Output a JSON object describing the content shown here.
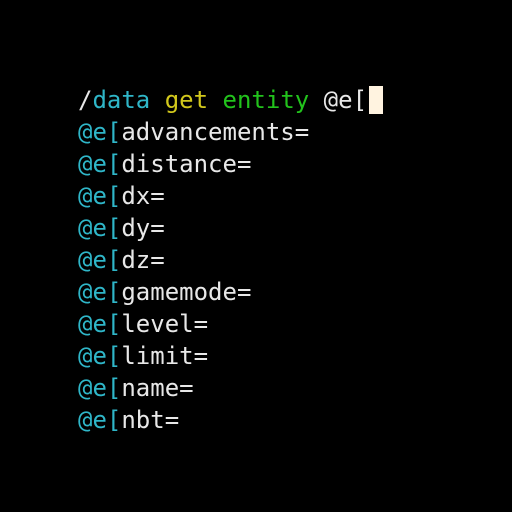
{
  "command_line": {
    "slash": "/",
    "command": "data",
    "subcommand": "get",
    "argument": "entity",
    "input": "@e["
  },
  "colors": {
    "background": "#000000",
    "command": "#2fb6c8",
    "subcommand": "#d2c81c",
    "argument": "#22c21c",
    "text": "#e8e8e8",
    "cursor": "#fff3e0"
  },
  "suggestions": [
    {
      "prefix": "@e[",
      "rest": "advancements="
    },
    {
      "prefix": "@e[",
      "rest": "distance="
    },
    {
      "prefix": "@e[",
      "rest": "dx="
    },
    {
      "prefix": "@e[",
      "rest": "dy="
    },
    {
      "prefix": "@e[",
      "rest": "dz="
    },
    {
      "prefix": "@e[",
      "rest": "gamemode="
    },
    {
      "prefix": "@e[",
      "rest": "level="
    },
    {
      "prefix": "@e[",
      "rest": "limit="
    },
    {
      "prefix": "@e[",
      "rest": "name="
    },
    {
      "prefix": "@e[",
      "rest": "nbt="
    }
  ]
}
